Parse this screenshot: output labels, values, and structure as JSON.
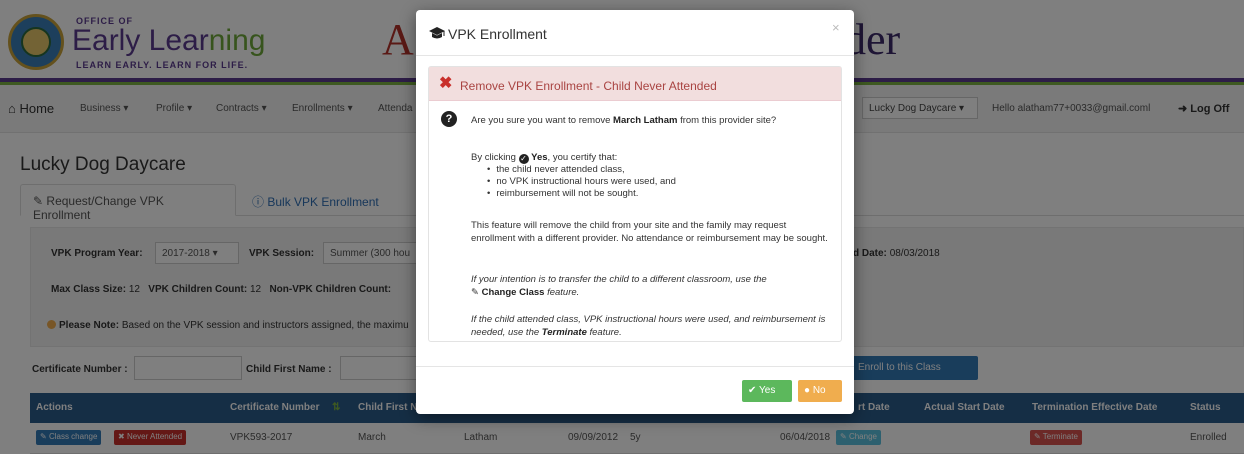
{
  "header": {
    "logo_office": "OFFICE OF",
    "logo_early": "Early Lear",
    "logo_ning": "ning",
    "logo_tagline": "LEARN EARLY. LEARN FOR LIFE.",
    "title_left": "A",
    "title_right": "der"
  },
  "nav": {
    "home": "Home",
    "items": [
      "Business ▾",
      "Profile ▾",
      "Contracts ▾",
      "Enrollments ▾",
      "Attenda"
    ],
    "provider_select": "Lucky Dog Daycare",
    "hello": "Hello alatham77+0033@gmail.coml",
    "logoff": "Log Off"
  },
  "page": {
    "site_title": "Lucky Dog Daycare",
    "tab_request": "Request/Change VPK Enrollment",
    "tab_bulk": "Bulk VPK Enrollment"
  },
  "filters": {
    "program_year_label": "VPK Program Year:",
    "program_year_value": "2017-2018",
    "session_label": "VPK Session:",
    "session_value": "Summer (300 hou",
    "end_date_label": "d Date:",
    "end_date_value": "08/03/2018",
    "max_class_label": "Max Class Size:",
    "max_class_value": "12",
    "vpk_count_label": "VPK Children Count:",
    "vpk_count_value": "12",
    "nonvpk_count_label": "Non-VPK Children Count:",
    "note_label": "Please Note:",
    "note_text": "Based on the VPK session and instructors assigned, the maximu"
  },
  "search": {
    "certificate_label": "Certificate Number :",
    "first_name_label": "Child First Name :",
    "enroll_button": "Enroll to this Class"
  },
  "table": {
    "headers": {
      "actions": "Actions",
      "certificate": "Certificate Number",
      "first_name": "Child First N",
      "start_date": "rt Date",
      "actual_start": "Actual Start Date",
      "termination": "Termination Effective Date",
      "status": "Status"
    },
    "row": {
      "class_change": "Class change",
      "never_attended": "Never Attended",
      "certificate": "VPK593-2017",
      "first_name": "March",
      "last_name": "Latham",
      "dob": "09/09/2012",
      "age": "5y",
      "start_date": "06/04/2018",
      "change": "Change",
      "terminate": "Terminate",
      "status": "Enrolled"
    }
  },
  "modal": {
    "title": "VPK Enrollment",
    "close": "×",
    "alert_title": "Remove VPK Enrollment - Child Never Attended",
    "question_pre": "Are you sure you want to remove ",
    "child_name": "March Latham",
    "question_post": " from this provider site?",
    "certify_pre": "By clicking ",
    "certify_yes": "Yes",
    "certify_post": ", you certify that:",
    "bullets": [
      "the child never attended class,",
      "no VPK instructional hours were used, and",
      "reimbursement will not be sought."
    ],
    "feature_text": "This feature will remove the child from your site and the family may request enrollment with a different provider. No attendance or reimbursement may be sought.",
    "transfer_pre": "If your intention is to transfer the child to a different classroom, use the",
    "transfer_feature": "Change Class",
    "transfer_post": " feature.",
    "terminate_pre": "If the child attended class, VPK instructional hours were used, and reimbursement is needed, use the ",
    "terminate_feature": "Terminate",
    "terminate_post": " feature.",
    "yes_button": "Yes",
    "no_button": "No"
  },
  "colors": {
    "table_header": "#2b5c8a",
    "danger": "#c9302c",
    "success": "#5cb85c",
    "warning": "#f0ad4e",
    "primary": "#337ab7"
  }
}
